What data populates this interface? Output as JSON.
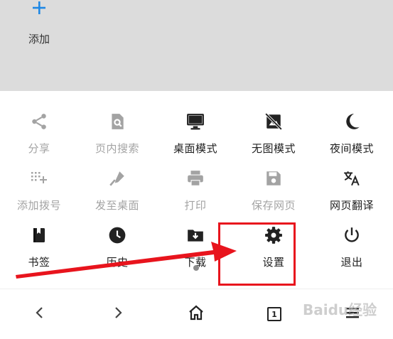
{
  "top": {
    "add_label": "添加"
  },
  "menu": {
    "rows": [
      [
        {
          "label": "分享",
          "icon": "share-icon",
          "state": "disabled"
        },
        {
          "label": "页内搜索",
          "icon": "find-in-page-icon",
          "state": "disabled"
        },
        {
          "label": "桌面模式",
          "icon": "desktop-icon",
          "state": "enabled"
        },
        {
          "label": "无图模式",
          "icon": "no-image-icon",
          "state": "enabled"
        },
        {
          "label": "夜间模式",
          "icon": "moon-icon",
          "state": "enabled"
        }
      ],
      [
        {
          "label": "添加拨号",
          "icon": "add-dial-icon",
          "state": "disabled"
        },
        {
          "label": "发至桌面",
          "icon": "send-to-desktop-icon",
          "state": "disabled"
        },
        {
          "label": "打印",
          "icon": "print-icon",
          "state": "disabled"
        },
        {
          "label": "保存网页",
          "icon": "save-icon",
          "state": "disabled"
        },
        {
          "label": "网页翻译",
          "icon": "translate-icon",
          "state": "enabled"
        }
      ],
      [
        {
          "label": "书签",
          "icon": "bookmark-icon",
          "state": "enabled"
        },
        {
          "label": "历史",
          "icon": "history-icon",
          "state": "enabled"
        },
        {
          "label": "下载",
          "icon": "download-icon",
          "state": "enabled"
        },
        {
          "label": "设置",
          "icon": "settings-icon",
          "state": "enabled"
        },
        {
          "label": "退出",
          "icon": "power-icon",
          "state": "enabled"
        }
      ]
    ]
  },
  "bottom": {
    "tab_count": "1",
    "icons": [
      "back-icon",
      "forward-icon",
      "home-icon",
      "tabs-icon",
      "menu-icon"
    ]
  },
  "annotation": {
    "highlight_color": "#e8141d"
  },
  "watermark": {
    "text": "Baidu经验"
  },
  "colors": {
    "accent": "#1e88e5",
    "disabled": "#a3a3a3",
    "enabled": "#222222"
  }
}
